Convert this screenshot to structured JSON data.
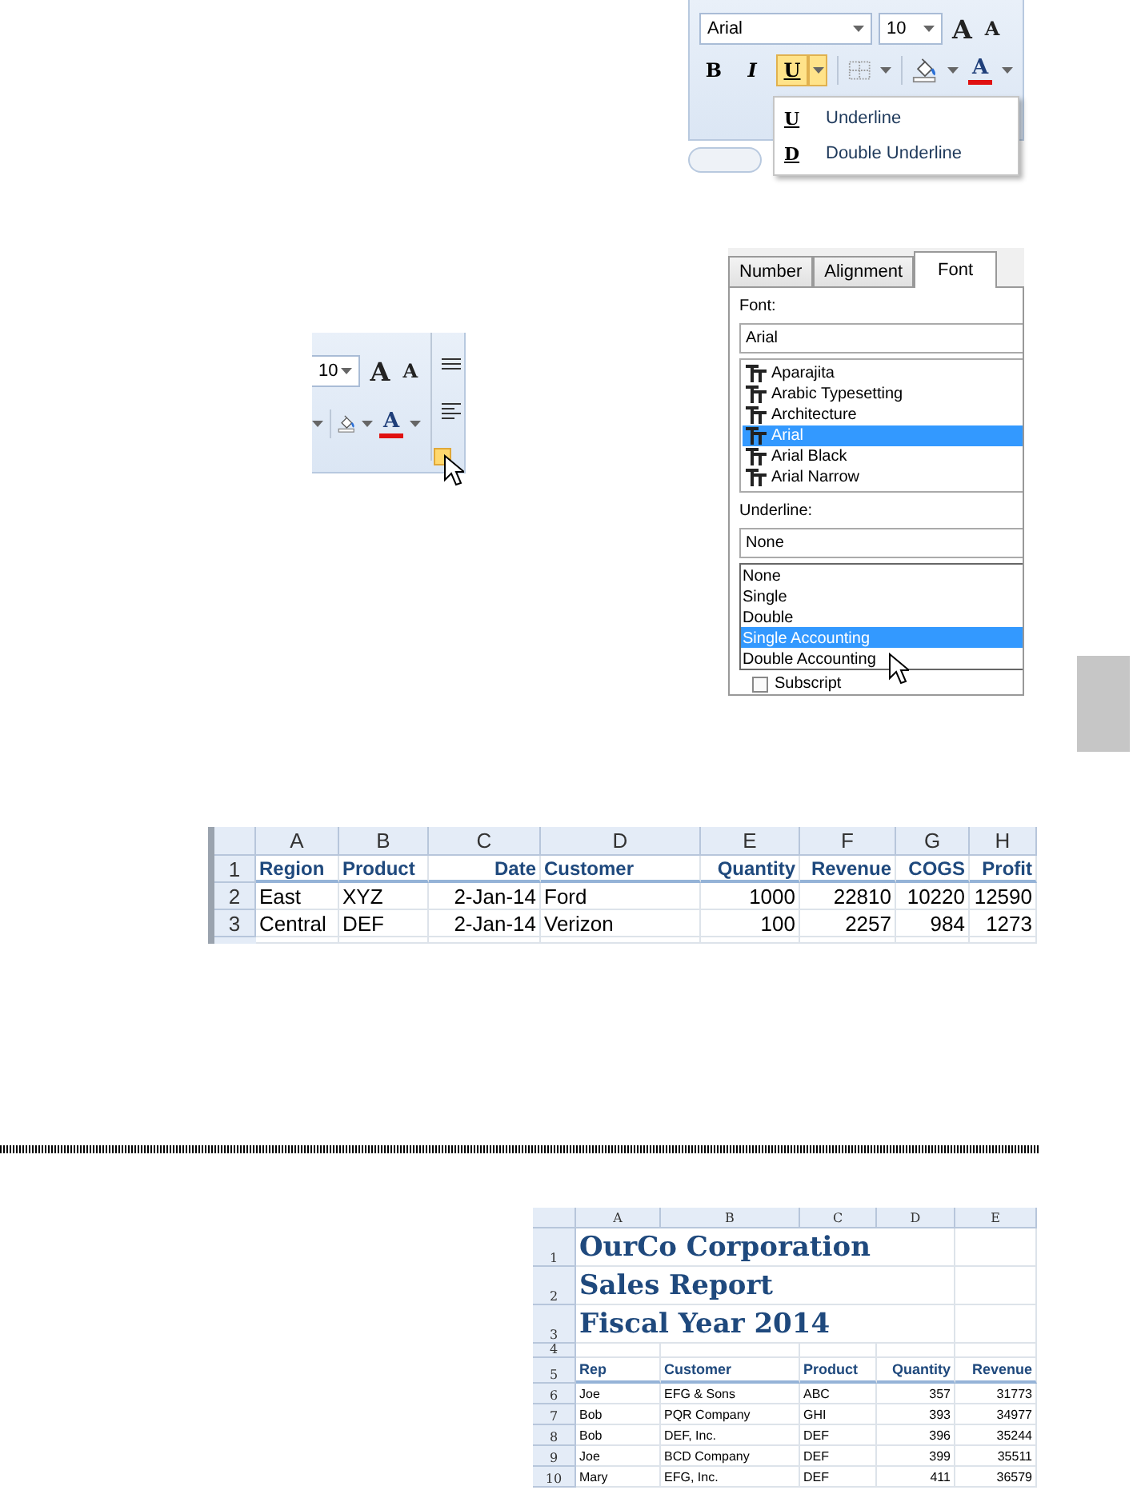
{
  "ribbon_menu_snippet": {
    "font_field": "Arial",
    "size_field": "10",
    "grow_label": "A",
    "shrink_label": "A",
    "bold_label": "B",
    "italic_label": "I",
    "underline_label": "U",
    "underline_active": true,
    "font_color_label": "A",
    "menu": [
      {
        "glyph": "U",
        "label": "Underline"
      },
      {
        "glyph": "D",
        "label": "Double Underline"
      }
    ]
  },
  "ribbon_launcher_snippet": {
    "size_field": "10",
    "grow_label": "A",
    "shrink_label": "A",
    "font_color_label": "A",
    "launcher_hovered": true
  },
  "format_dialog": {
    "tabs": [
      {
        "label": "Number",
        "selected": false
      },
      {
        "label": "Alignment",
        "selected": false
      },
      {
        "label": "Font",
        "selected": true
      }
    ],
    "font_label": "Font:",
    "font_field": "Arial",
    "fonts": [
      {
        "name": "Aparajita",
        "selected": false
      },
      {
        "name": "Arabic Typesetting",
        "selected": false
      },
      {
        "name": "Architecture",
        "selected": false
      },
      {
        "name": "Arial",
        "selected": true
      },
      {
        "name": "Arial Black",
        "selected": false
      },
      {
        "name": "Arial Narrow",
        "selected": false
      }
    ],
    "underline_label": "Underline:",
    "underline_field": "None",
    "underline_options": [
      {
        "label": "None",
        "selected": false
      },
      {
        "label": "Single",
        "selected": false
      },
      {
        "label": "Double",
        "selected": false
      },
      {
        "label": "Single Accounting",
        "selected": true
      },
      {
        "label": "Double Accounting",
        "selected": false
      }
    ],
    "subscript": {
      "label": "Subscript",
      "checked": false
    }
  },
  "sales_sheet": {
    "columns": [
      {
        "letter": "A",
        "numeric": false
      },
      {
        "letter": "B",
        "numeric": false
      },
      {
        "letter": "C",
        "numeric": true
      },
      {
        "letter": "D",
        "numeric": false
      },
      {
        "letter": "E",
        "numeric": true
      },
      {
        "letter": "F",
        "numeric": true
      },
      {
        "letter": "G",
        "numeric": true
      },
      {
        "letter": "H",
        "numeric": true
      }
    ],
    "rows": [
      {
        "number": "1",
        "kind": "header",
        "cells": [
          "Region",
          "Product",
          "Date",
          "Customer",
          "Quantity",
          "Revenue",
          "COGS",
          "Profit"
        ]
      },
      {
        "number": "2",
        "kind": "data",
        "cells": [
          "East",
          "XYZ",
          "2-Jan-14",
          "Ford",
          "1000",
          "22810",
          "10220",
          "12590"
        ]
      },
      {
        "number": "3",
        "kind": "data",
        "cells": [
          "Central",
          "DEF",
          "2-Jan-14",
          "Verizon",
          "100",
          "2257",
          "984",
          "1273"
        ]
      }
    ]
  },
  "report_sheet": {
    "columns": [
      {
        "letter": "A",
        "numeric": false
      },
      {
        "letter": "B",
        "numeric": false
      },
      {
        "letter": "C",
        "numeric": false
      },
      {
        "letter": "D",
        "numeric": true
      },
      {
        "letter": "E",
        "numeric": true
      }
    ],
    "rows": [
      {
        "number": "1",
        "kind": "title",
        "cells": [
          "OurCo Corporation"
        ]
      },
      {
        "number": "2",
        "kind": "title",
        "cells": [
          "Sales Report"
        ]
      },
      {
        "number": "3",
        "kind": "title",
        "cells": [
          "Fiscal Year 2014"
        ]
      },
      {
        "number": "4",
        "kind": "blank",
        "cells": []
      },
      {
        "number": "5",
        "kind": "header",
        "cells": [
          "Rep",
          "Customer",
          "Product",
          "Quantity",
          "Revenue"
        ]
      },
      {
        "number": "6",
        "kind": "data",
        "cells": [
          "Joe",
          "EFG & Sons",
          "ABC",
          "357",
          "31773"
        ]
      },
      {
        "number": "7",
        "kind": "data",
        "cells": [
          "Bob",
          "PQR Company",
          "GHI",
          "393",
          "34977"
        ]
      },
      {
        "number": "8",
        "kind": "data",
        "cells": [
          "Bob",
          "DEF, Inc.",
          "DEF",
          "396",
          "35244"
        ]
      },
      {
        "number": "9",
        "kind": "data",
        "cells": [
          "Joe",
          "BCD Company",
          "DEF",
          "399",
          "35511"
        ]
      },
      {
        "number": "10",
        "kind": "data",
        "cells": [
          "Mary",
          "EFG, Inc.",
          "DEF",
          "411",
          "36579"
        ]
      }
    ]
  }
}
